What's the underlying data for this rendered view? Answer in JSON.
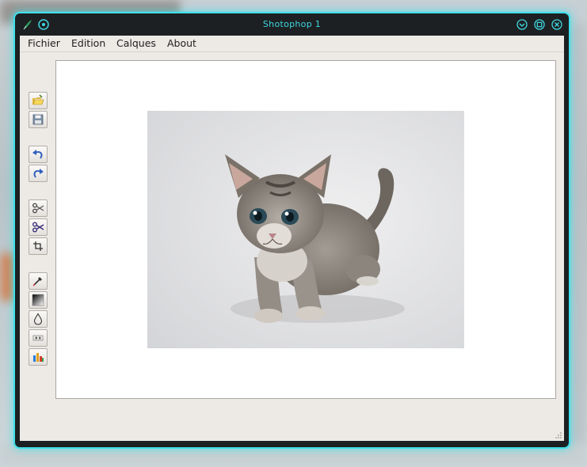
{
  "window": {
    "title": "Shotophop 1",
    "accent_color": "#3fe0ea",
    "icons": [
      "app-icon",
      "sticky-icon",
      "minimize-icon",
      "maximize-icon",
      "close-icon"
    ]
  },
  "menubar": {
    "items": [
      {
        "label": "Fichier"
      },
      {
        "label": "Edition"
      },
      {
        "label": "Calques"
      },
      {
        "label": "About"
      }
    ]
  },
  "toolbar": {
    "groups": [
      [
        "open-icon",
        "save-icon"
      ],
      [
        "undo-icon",
        "redo-icon"
      ],
      [
        "cut-icon",
        "scissors-icon",
        "crop-icon"
      ],
      [
        "eyedropper-icon",
        "gradient-icon",
        "drop-icon",
        "resize-icon",
        "histogram-icon"
      ]
    ]
  },
  "canvas": {
    "image": "kitten-photo",
    "background": "#ffffff"
  }
}
